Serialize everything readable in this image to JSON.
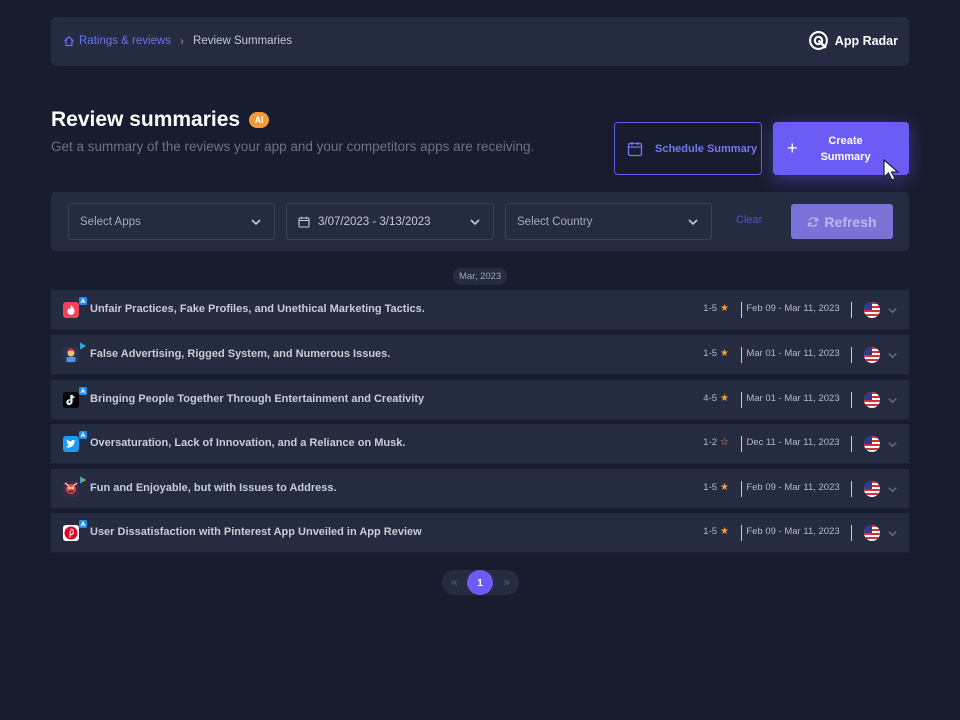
{
  "breadcrumb": {
    "home_label": "Ratings & reviews",
    "current": "Review Summaries"
  },
  "brand": {
    "name": "App Radar"
  },
  "header": {
    "title": "Review summaries",
    "badge": "AI",
    "subtitle": "Get a summary of the reviews your app and your competitors apps are receiving."
  },
  "actions": {
    "schedule_label": "Schedule Summary",
    "create_line1": "Create",
    "create_line2": "Summary"
  },
  "filters": {
    "apps_placeholder": "Select Apps",
    "date_range": "3/07/2023 - 3/13/2023",
    "country_placeholder": "Select Country",
    "clear_label": "Clear",
    "refresh_label": "Refresh"
  },
  "month_label": "Mar, 2023",
  "summaries": [
    {
      "title": "Unfair Practices, Fake Profiles, and Unethical Marketing Tactics.",
      "rating": "1-5",
      "range": "Feb 09 - Mar 11, 2023",
      "app_icon": "tinder-icon",
      "store": "app-store-icon",
      "flag": "us-flag-icon"
    },
    {
      "title": "False Advertising, Rigged System, and Numerous Issues.",
      "rating": "1-5",
      "range": "Mar 01 - Mar 11, 2023",
      "app_icon": "game-character-icon",
      "store": "google-play-icon",
      "flag": "us-flag-icon"
    },
    {
      "title": "Bringing People Together Through Entertainment and Creativity",
      "rating": "4-5",
      "range": "Mar 01 - Mar 11, 2023",
      "app_icon": "tiktok-icon",
      "store": "app-store-icon",
      "flag": "us-flag-icon"
    },
    {
      "title": "Oversaturation, Lack of Innovation, and a Reliance on Musk.",
      "rating": "1-2",
      "range": "Dec 11 - Mar 11, 2023",
      "app_icon": "twitter-icon",
      "store": "app-store-icon",
      "flag": "us-flag-icon"
    },
    {
      "title": "Fun and Enjoyable, but with Issues to Address.",
      "rating": "1-5",
      "range": "Feb 09 - Mar 11, 2023",
      "app_icon": "game-character-icon",
      "store": "google-play-icon",
      "flag": "us-flag-icon"
    },
    {
      "title": "User Dissatisfaction with Pinterest App Unveiled in App Review",
      "rating": "1-5",
      "range": "Feb 09 - Mar 11, 2023",
      "app_icon": "pinterest-icon",
      "store": "app-store-icon",
      "flag": "us-flag-icon"
    }
  ],
  "pagination": {
    "prev": "«",
    "current": "1",
    "next": "»"
  },
  "colors": {
    "background": "#171c2e",
    "panel": "#252b40",
    "accent": "#6a5cf5",
    "star": "#f0a23a",
    "badge": "#f09a3a"
  }
}
